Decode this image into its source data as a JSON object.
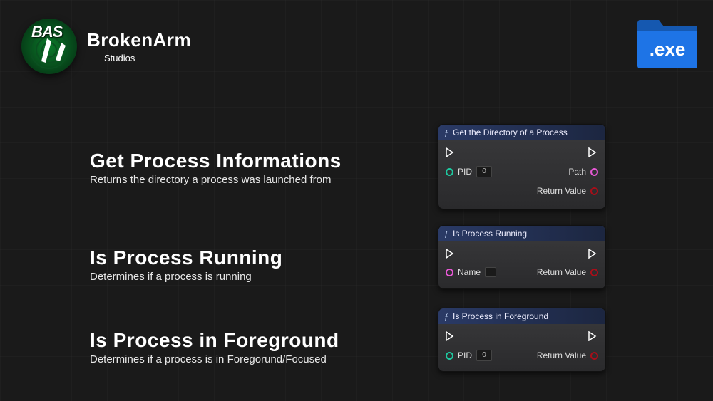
{
  "brand": {
    "logo_text": "BAS",
    "title": "BrokenArm",
    "subtitle": "Studios"
  },
  "exe_icon_label": ".exe",
  "sections": [
    {
      "title": "Get Process Informations",
      "subtitle": "Returns the directory a process was launched from"
    },
    {
      "title": "Is Process Running",
      "subtitle": "Determines if a process is running"
    },
    {
      "title": "Is Process in Foreground",
      "subtitle": "Determines if a process is in Foregorund/Focused"
    }
  ],
  "nodes": {
    "get_dir": {
      "title": "Get the Directory of a Process",
      "pid_label": "PID",
      "pid_value": "0",
      "path_label": "Path",
      "return_label": "Return Value"
    },
    "is_running": {
      "title": "Is Process Running",
      "name_label": "Name",
      "return_label": "Return Value"
    },
    "is_foreground": {
      "title": "Is Process in Foreground",
      "pid_label": "PID",
      "pid_value": "0",
      "return_label": "Return Value"
    }
  },
  "colors": {
    "exec": "#ffffff",
    "int": "#1ec9a0",
    "string": "#e658d4",
    "bool": "#a80e19"
  }
}
